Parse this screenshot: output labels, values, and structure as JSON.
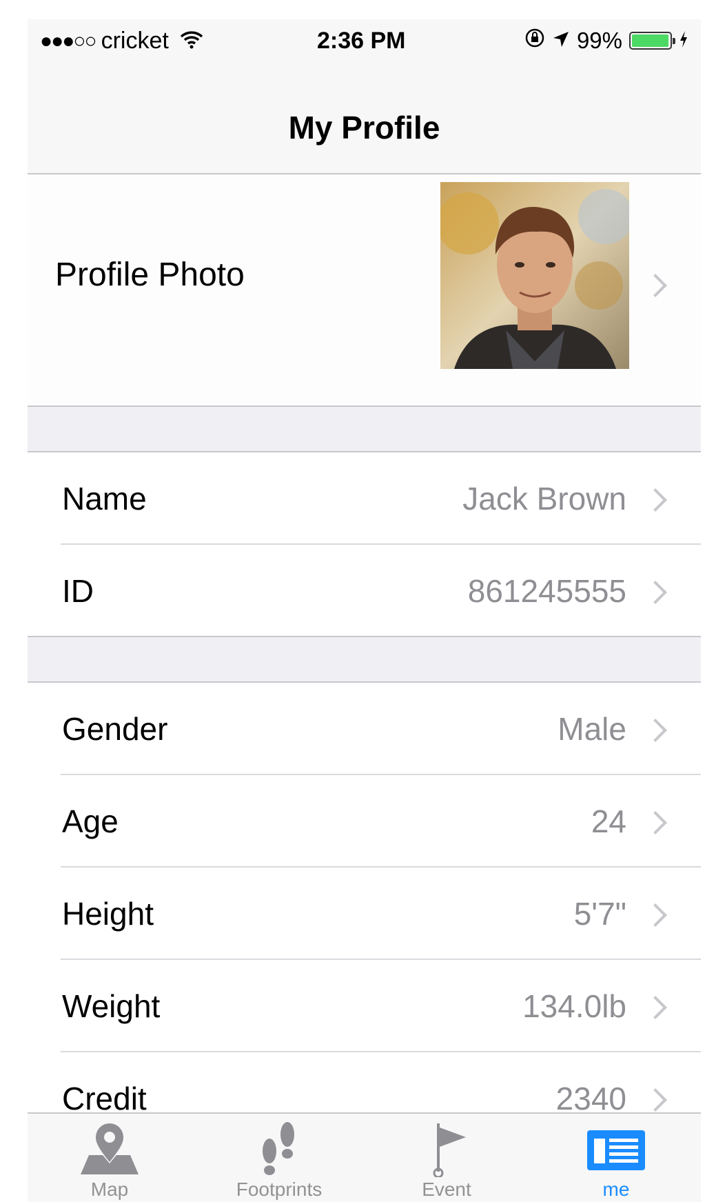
{
  "status_bar": {
    "signal": "●●●○○",
    "carrier": "cricket",
    "time": "2:36 PM",
    "battery": "99%",
    "battery_level": 0.99
  },
  "nav": {
    "title": "My Profile"
  },
  "profile_photo": {
    "label": "Profile Photo"
  },
  "rows_section1": [
    {
      "label": "Name",
      "value": "Jack Brown"
    },
    {
      "label": "ID",
      "value": "861245555"
    }
  ],
  "rows_section2": [
    {
      "label": "Gender",
      "value": "Male"
    },
    {
      "label": "Age",
      "value": "24"
    },
    {
      "label": "Height",
      "value": "5'7\""
    },
    {
      "label": "Weight",
      "value": "134.0lb"
    },
    {
      "label": "Credit",
      "value": "2340"
    }
  ],
  "tabs": [
    {
      "label": "Map",
      "icon": "map-pin-icon"
    },
    {
      "label": "Footprints",
      "icon": "footprints-icon"
    },
    {
      "label": "Event",
      "icon": "flag-icon"
    },
    {
      "label": "me",
      "icon": "profile-card-icon",
      "active": true
    }
  ],
  "colors": {
    "accent": "#1a8cff",
    "secondary_text": "#8e8e93"
  }
}
